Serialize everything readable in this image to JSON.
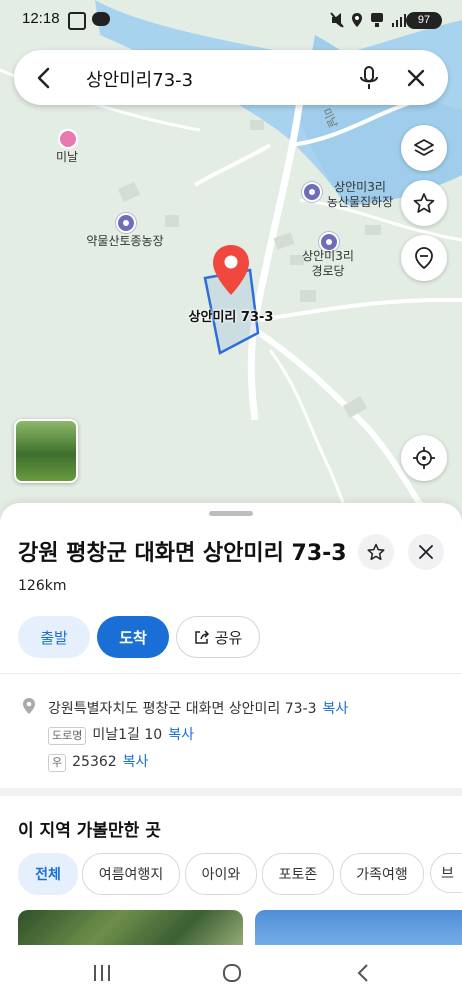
{
  "status_bar": {
    "time": "12:18",
    "battery": "97"
  },
  "search": {
    "query": "상안미리73-3"
  },
  "map": {
    "pois": [
      {
        "label": "미날"
      },
      {
        "label": "약물산토종농장"
      },
      {
        "label": "상안미3리\n농산물집하장"
      },
      {
        "label": "상안미3리\n경로당"
      }
    ],
    "road_label": "미날",
    "pin_label": "상안미리 73-3",
    "colors": {
      "water": "#a8d3ef",
      "land": "#e3ede4",
      "parcel_outline": "#2d6fd8",
      "pin": "#f0483e"
    }
  },
  "sheet": {
    "title": "강원 평창군 대화면 상안미리 73-3",
    "distance": "126km",
    "actions": {
      "depart": "출발",
      "arrive": "도착",
      "share": "공유"
    },
    "address": {
      "full": "강원특별자치도 평창군 대화면 상안미리 73-3",
      "copy": "복사",
      "road_tag": "도로명",
      "road": "미날1길 10",
      "postal_tag": "우",
      "postal": "25362"
    },
    "nearby": {
      "title": "이 지역 가볼만한 곳",
      "chips": [
        "전체",
        "여름여행지",
        "아이와",
        "포토존",
        "가족여행",
        "브"
      ]
    }
  }
}
